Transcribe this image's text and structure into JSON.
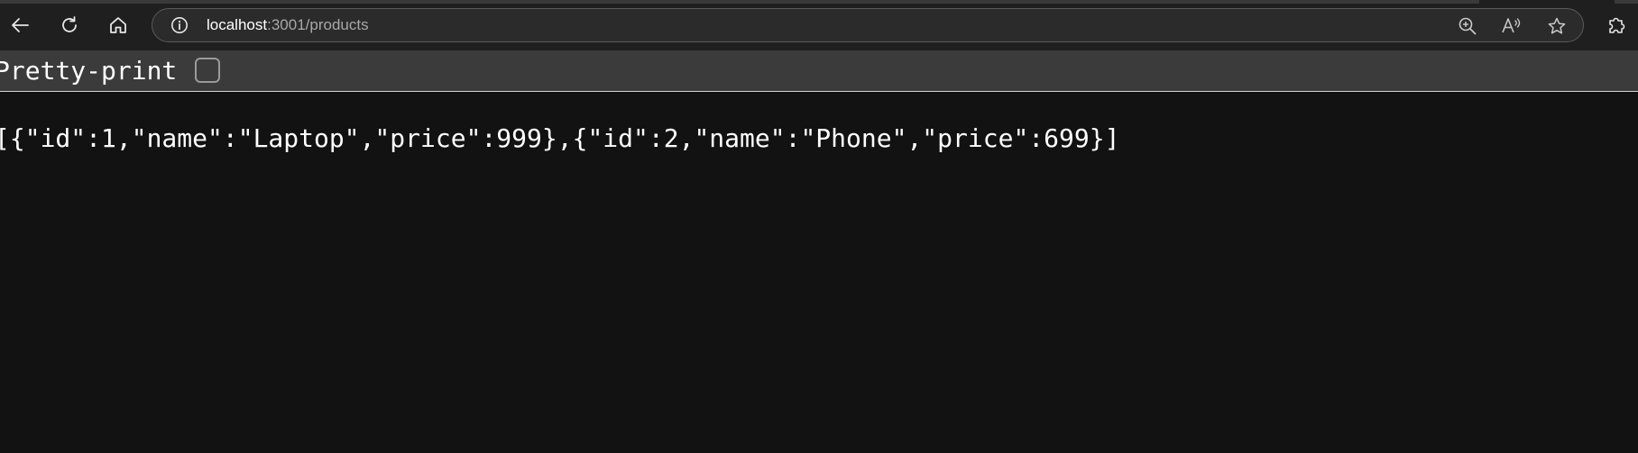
{
  "browser": {
    "address": {
      "host": "localhost",
      "path": ":3001/products"
    },
    "icons": {
      "back": "back-arrow-icon",
      "refresh": "refresh-icon",
      "home": "home-icon",
      "site_info": "info-icon",
      "zoom": "zoom-in-icon",
      "read_aloud": "read-aloud-icon",
      "favorite": "star-icon",
      "extensions": "puzzle-icon"
    }
  },
  "viewer": {
    "pretty_print_label": "Pretty-print",
    "pretty_print_checked": false,
    "raw_json": "[{\"id\":1,\"name\":\"Laptop\",\"price\":999},{\"id\":2,\"name\":\"Phone\",\"price\":699}]"
  },
  "colors": {
    "page_background": "#121212",
    "toolbar_background": "#1f1f1f",
    "pretty_bar_background": "#3b3b3b",
    "text": "#ffffff",
    "url_path": "#a8a8a8"
  }
}
